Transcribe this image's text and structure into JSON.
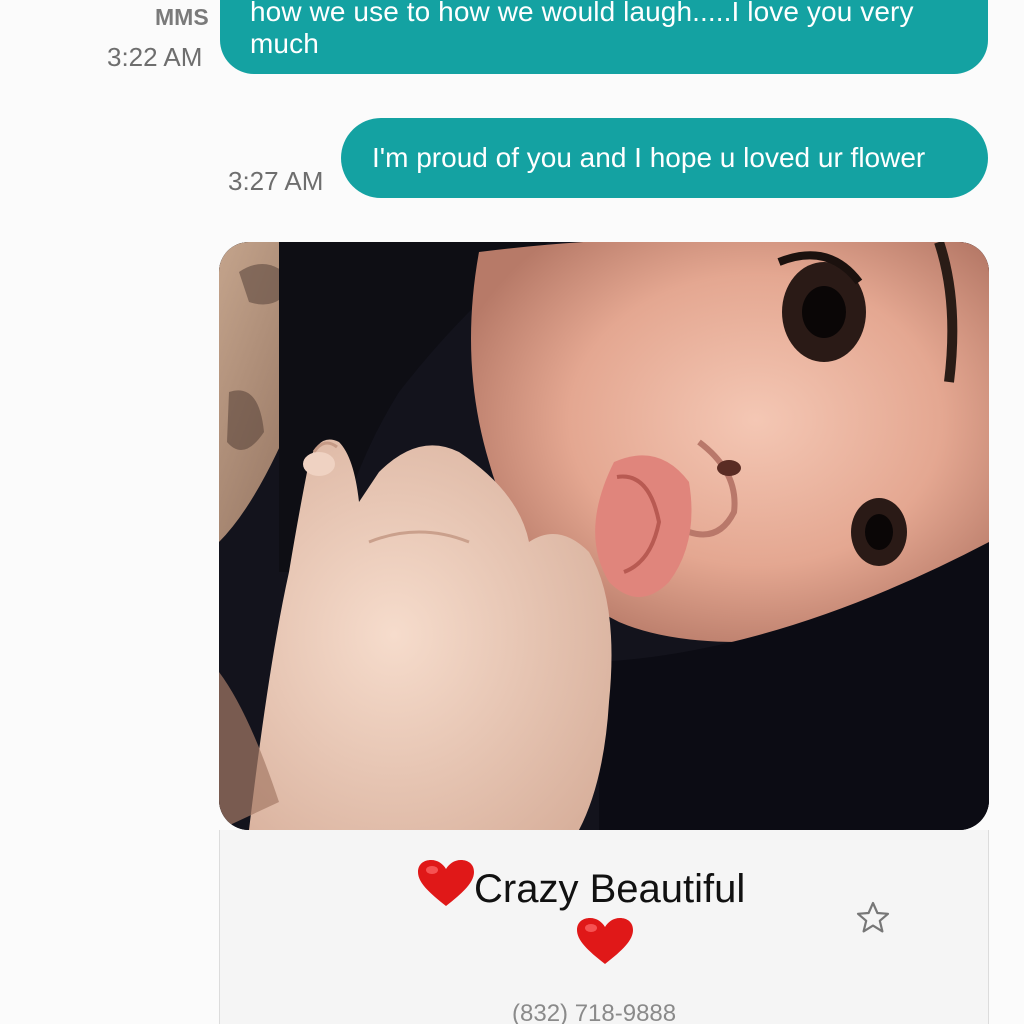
{
  "conversation": {
    "message1": {
      "type_label": "MMS",
      "text": "how we use to how we would laugh.....I love you very much",
      "time": "3:22 AM"
    },
    "message2": {
      "text": "I'm proud of you and I hope u loved ur flower",
      "time": "3:27 AM"
    },
    "message3": {
      "image_icon": "photo",
      "caption": "Crazy Beautiful",
      "caption_icons": [
        "red-heart-icon",
        "red-heart-icon"
      ],
      "favorite_icon": "star-outline-icon",
      "sender_number": "(832) 718-9888"
    }
  },
  "colors": {
    "bubble": "#14a2a2",
    "background": "#fbfbfb",
    "timestamp": "#6e6e6e",
    "heart": "#e01818"
  }
}
